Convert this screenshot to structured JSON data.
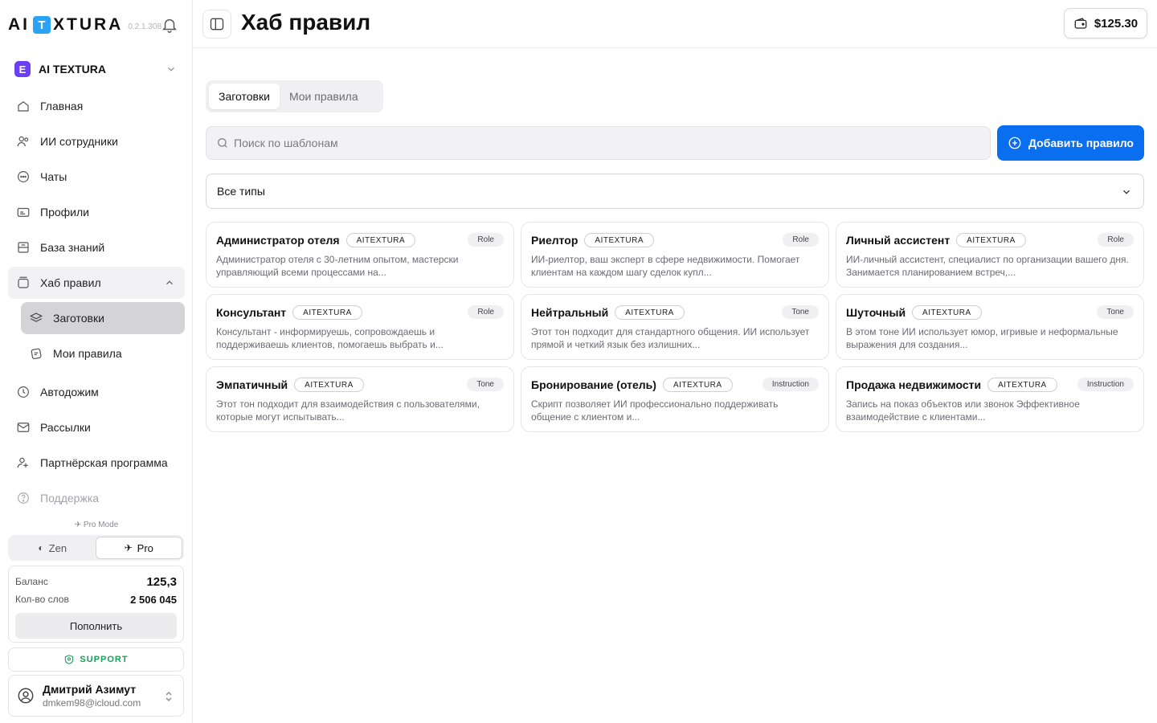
{
  "app": {
    "logo_left": "AI",
    "logo_mark": "T",
    "logo_right": "XTURA",
    "version": "0.2.1.308"
  },
  "sidebar": {
    "workspace": {
      "icon": "E",
      "label": "AI TEXTURA"
    },
    "items": [
      {
        "label": "Главная",
        "icon": "home-icon"
      },
      {
        "label": "ИИ сотрудники",
        "icon": "users-icon"
      },
      {
        "label": "Чаты",
        "icon": "chat-icon"
      },
      {
        "label": "Профили",
        "icon": "id-card-icon"
      },
      {
        "label": "База знаний",
        "icon": "database-icon"
      },
      {
        "label": "Хаб правил",
        "icon": "folder-icon"
      },
      {
        "label": "Заготовки",
        "icon": "layers-icon"
      },
      {
        "label": "Мои правила",
        "icon": "rules-icon"
      },
      {
        "label": "Автодожим",
        "icon": "clock-icon"
      },
      {
        "label": "Рассылки",
        "icon": "mail-icon"
      },
      {
        "label": "Партнёрская программа",
        "icon": "partner-icon"
      },
      {
        "label": "Поддержка",
        "icon": "help-icon"
      }
    ],
    "pro_mode_label": "Pro Mode",
    "modes": [
      {
        "label": "Zen",
        "active": false
      },
      {
        "label": "Pro",
        "active": true
      }
    ],
    "balance": {
      "balance_label": "Баланс",
      "balance_value": "125,3",
      "words_label": "Кол-во слов",
      "words_value": "2 506 045",
      "topup_label": "Пополнить"
    },
    "support_label": "SUPPORT",
    "user": {
      "name": "Дмитрий Азимут",
      "email": "dmkem98@icloud.com"
    }
  },
  "header": {
    "title": "Хаб правил",
    "wallet": "$125.30"
  },
  "main": {
    "tabs": [
      {
        "label": "Заготовки",
        "active": true
      },
      {
        "label": "Мои правила",
        "active": false
      }
    ],
    "search": {
      "placeholder": "Поиск по шаблонам",
      "value": ""
    },
    "add_button": "Добавить правило",
    "type_filter": "Все типы",
    "cards": [
      {
        "title": "Администратор отеля",
        "badge": "AITEXTURA",
        "type": "Role",
        "desc": "Администратор отеля с 30-летним опытом, мастерски управляющий всеми процессами на..."
      },
      {
        "title": "Риелтор",
        "badge": "AITEXTURA",
        "type": "Role",
        "desc": "ИИ-риелтор, ваш эксперт в сфере недвижимости. Помогает клиентам на каждом шагу сделок купл..."
      },
      {
        "title": "Личный ассистент",
        "badge": "AITEXTURA",
        "type": "Role",
        "desc": "ИИ-личный ассистент, специалист по организации вашего дня. Занимается планированием встреч,..."
      },
      {
        "title": "Консультант",
        "badge": "AITEXTURA",
        "type": "Role",
        "desc": "Консультант - информируешь, сопровождаешь и поддерживаешь клиентов, помогаешь выбрать и..."
      },
      {
        "title": "Нейтральный",
        "badge": "AITEXTURA",
        "type": "Tone",
        "desc": "Этот тон подходит для стандартного общения. ИИ использует прямой и четкий язык без излишних..."
      },
      {
        "title": "Шуточный",
        "badge": "AITEXTURA",
        "type": "Tone",
        "desc": "В этом тоне ИИ использует юмор, игривые и неформальные выражения для создания..."
      },
      {
        "title": "Эмпатичный",
        "badge": "AITEXTURA",
        "type": "Tone",
        "desc": "Этот тон подходит для взаимодействия с пользователями, которые могут испытывать..."
      },
      {
        "title": "Бронирование (отель)",
        "badge": "AITEXTURA",
        "type": "Instruction",
        "desc": "Скрипт позволяет ИИ профессионально поддерживать общение с клиентом и..."
      },
      {
        "title": "Продажа недвижимости",
        "badge": "AITEXTURA",
        "type": "Instruction",
        "desc": "Запись на показ объектов или звонок Эффективное взаимодействие с клиентами..."
      }
    ]
  },
  "colors": {
    "accent": "#0a6ef0",
    "workspace_icon": "#6b3ff5",
    "logo_mark": "#2aa3f5",
    "support": "#18a058",
    "active_nav": "#d4d4d8"
  }
}
